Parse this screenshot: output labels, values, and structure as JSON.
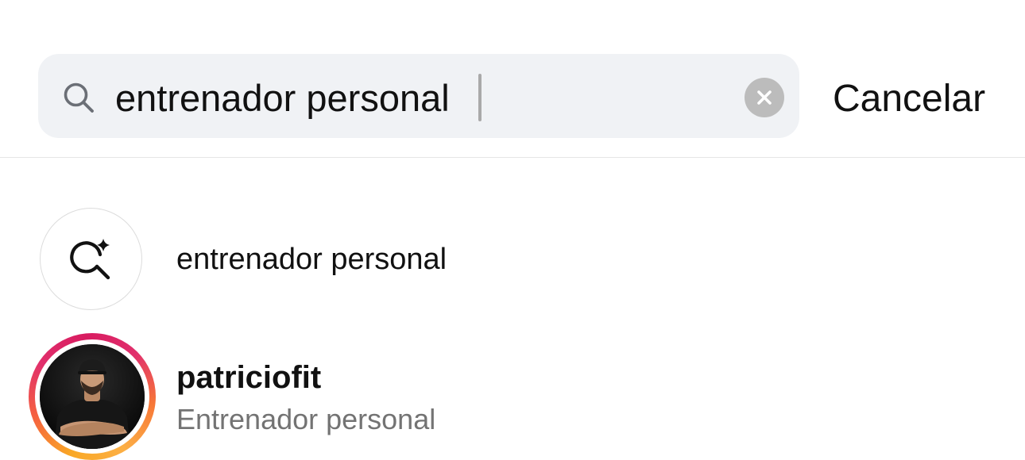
{
  "search": {
    "query": "entrenador personal",
    "cancel_label": "Cancelar"
  },
  "suggestion": {
    "icon": "ai-search-sparkle-icon",
    "label": "entrenador personal"
  },
  "account": {
    "username": "patriciofit",
    "full_name": "Entrenador personal",
    "has_story_ring": true
  },
  "colors": {
    "search_bg": "#f0f2f5",
    "clear_button": "#bcbcbc",
    "secondary_text": "#737373",
    "story_ring": [
      "#fcaf45",
      "#f77737",
      "#e1306c",
      "#d81b60"
    ]
  }
}
